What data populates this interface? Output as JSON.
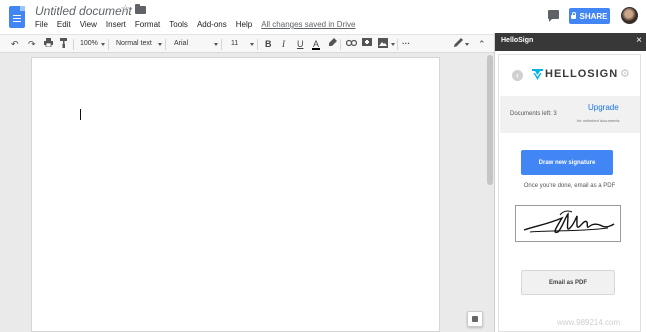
{
  "header": {
    "title": "Untitled document",
    "menu": [
      "File",
      "Edit",
      "View",
      "Insert",
      "Format",
      "Tools",
      "Add-ons",
      "Help"
    ],
    "saved_status": "All changes saved in Drive",
    "share_label": "SHARE"
  },
  "toolbar": {
    "zoom": "100%",
    "style": "Normal text",
    "font": "Arial",
    "font_size": "11",
    "bold_label": "B",
    "italic_label": "I",
    "underline_label": "U",
    "color_label": "A",
    "more_label": "···"
  },
  "sidebar": {
    "title": "HelloSign",
    "logo_text": "HELLOSIGN",
    "documents_left": "Documents left: 3",
    "upgrade_label": "Upgrade",
    "upgrade_sub": "for unlimited documents",
    "draw_button": "Draw new signature",
    "hint": "Once you're done, email as a PDF",
    "email_button": "Email as PDF"
  },
  "watermark": "www.989214.com",
  "colors": {
    "accent": "#4285f4",
    "sidebar_header": "#383838",
    "hellosign_teal": "#00b3e6"
  },
  "icons": [
    "docs-logo-icon",
    "star-icon",
    "folder-icon",
    "comment-icon",
    "lock-icon",
    "undo-icon",
    "redo-icon",
    "print-icon",
    "paint-format-icon",
    "link-icon",
    "comment-add-icon",
    "image-icon",
    "pen-icon",
    "collapse-icon",
    "close-icon",
    "back-icon",
    "settings-icon",
    "explore-icon"
  ]
}
